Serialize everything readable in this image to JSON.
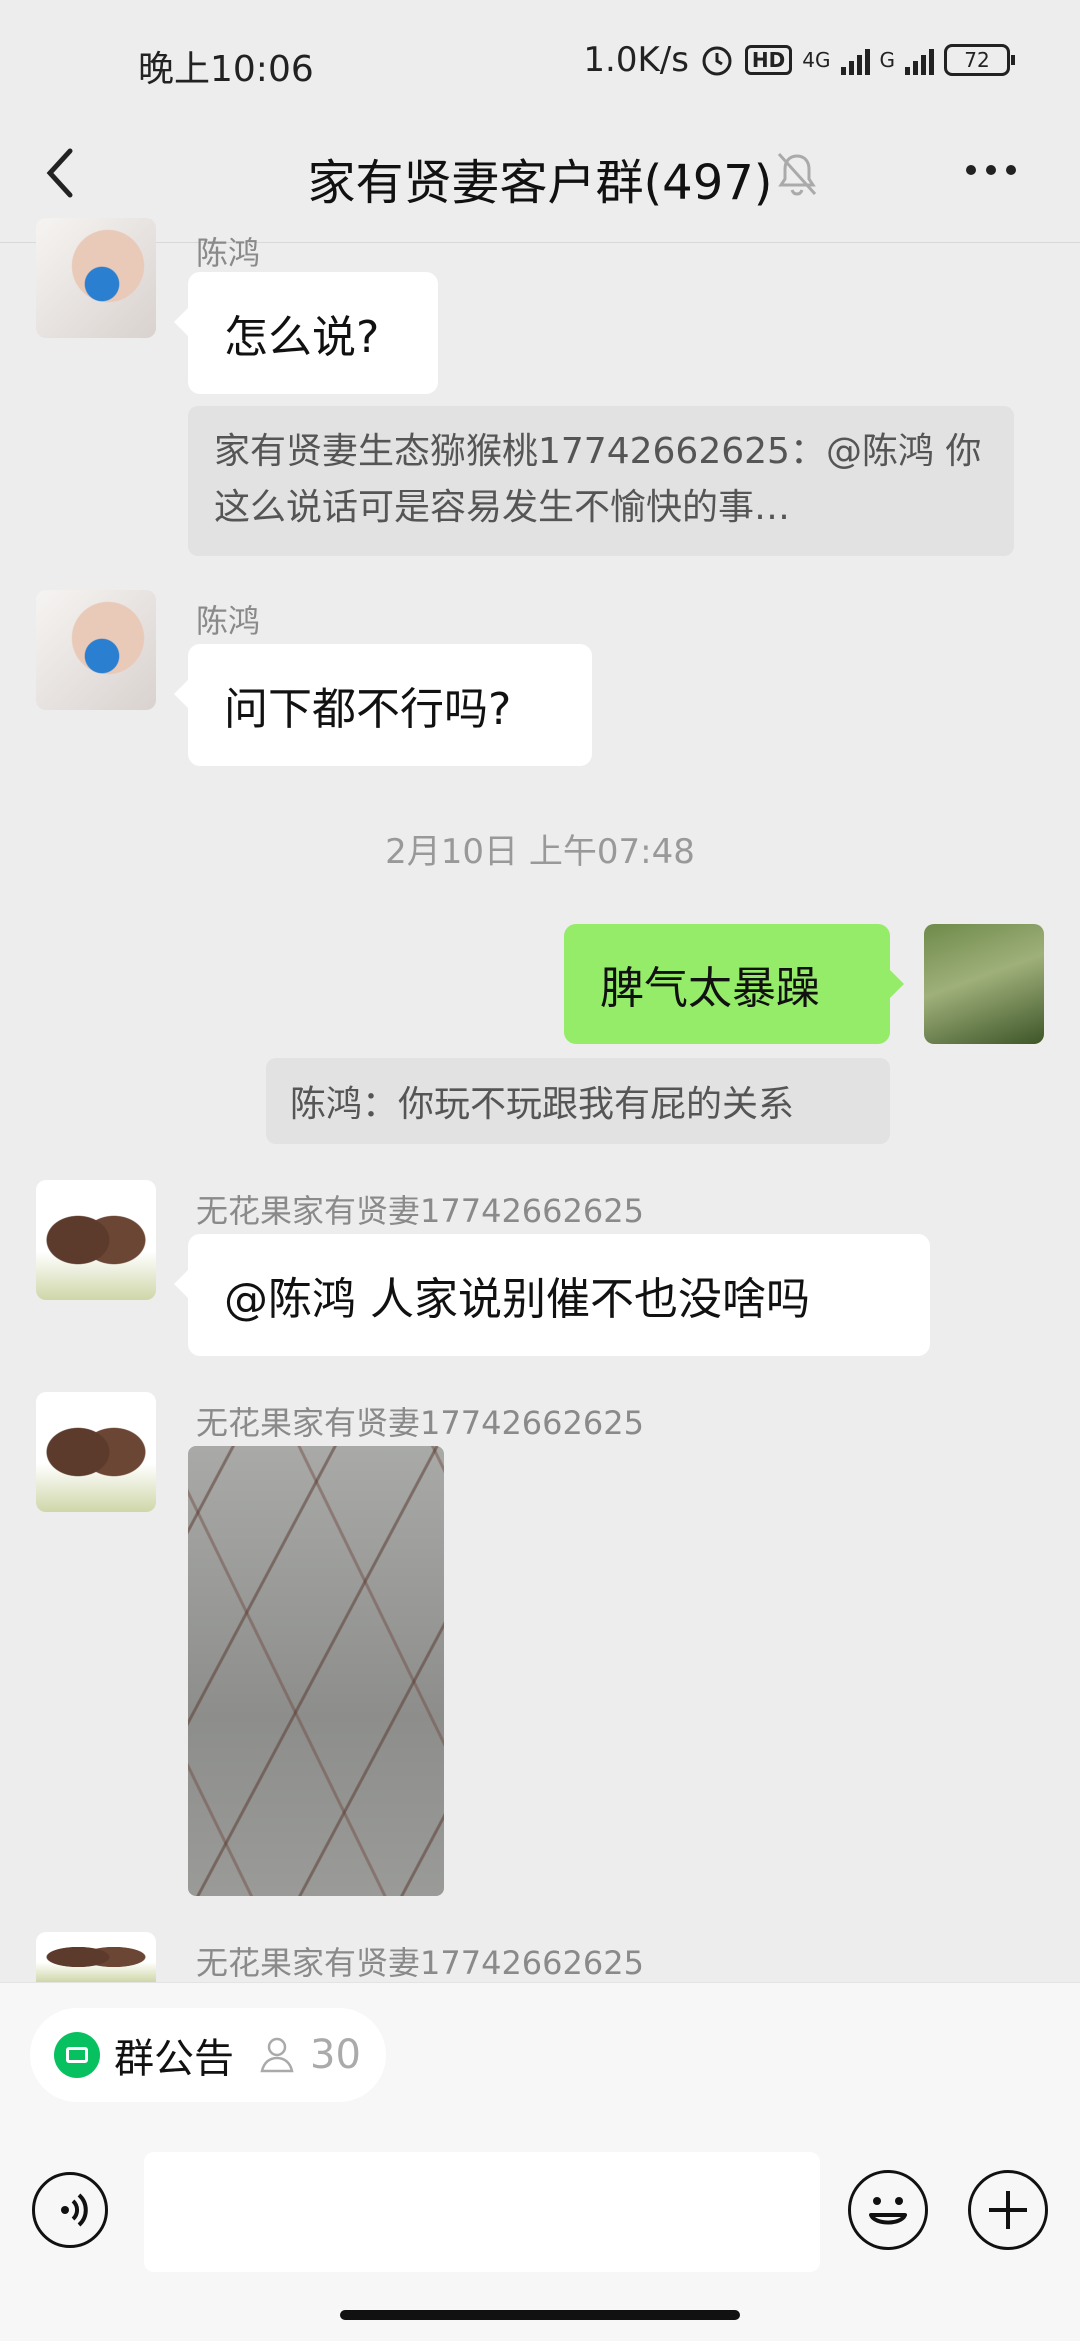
{
  "status_bar": {
    "time": "晚上10:06",
    "speed": "1.0K/s",
    "hd": "HD",
    "net1": "4G",
    "net2": "G",
    "battery": "72"
  },
  "header": {
    "title": "家有贤妻客户群(497)"
  },
  "messages": [
    {
      "sender": "陈鸿",
      "text": "怎么说?"
    },
    {
      "quote": "家有贤妻生态猕猴桃17742662625：@陈鸿 你这么说话可是容易发生不愉快的事…"
    },
    {
      "sender": "陈鸿",
      "text": "问下都不行吗?"
    },
    {
      "timestamp": "2月10日 上午07:48"
    },
    {
      "text": "脾气太暴躁"
    },
    {
      "quote": "陈鸿：你玩不玩跟我有屁的关系"
    },
    {
      "sender": "无花果家有贤妻17742662625",
      "text": "@陈鸿  人家说别催不也没啥吗"
    },
    {
      "sender": "无花果家有贤妻17742662625"
    },
    {
      "sender": "无花果家有贤妻17742662625"
    }
  ],
  "bottom": {
    "notice_label": "群公告",
    "member_count": "30",
    "input_value": ""
  },
  "colors": {
    "accent_green": "#95ec69",
    "wechat_green": "#07c160",
    "background": "#ededed"
  }
}
